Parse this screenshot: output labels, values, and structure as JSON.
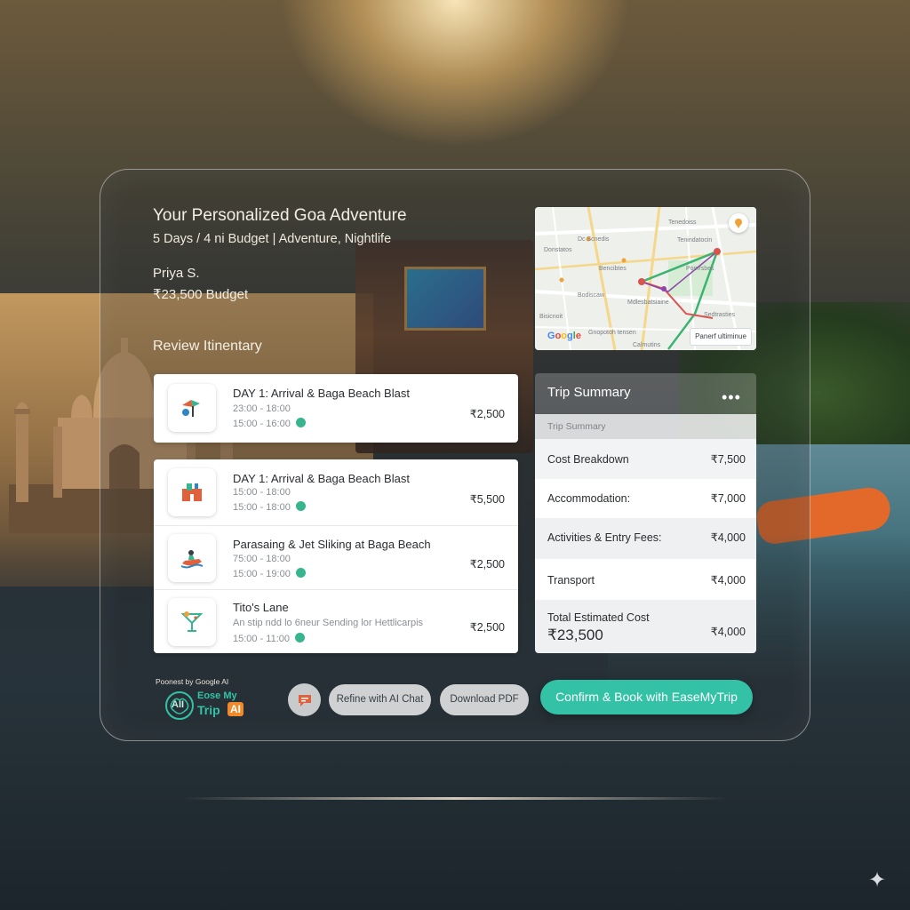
{
  "hero": {
    "title": "Your Personalized Goa Adventure",
    "subtitle": "5 Days / 4 ni Budget | Adventure, Nightlife",
    "user_name": "Priya S.",
    "user_budget": "₹23,500 Budget",
    "review_label": "Review Itinentary"
  },
  "itinerary": [
    {
      "title": "DAY 1: Arrival & Baga Beach Blast",
      "line1": "23:00 - 18:00",
      "line2": "15:00 - 16:00",
      "price": "₹2,500",
      "icon": "beach-icon"
    },
    {
      "title": "DAY 1: Arrival & Baga Beach Blast",
      "line1": "15:00 - 18:00",
      "line2": "15:00 - 18:00",
      "price": "₹5,500",
      "icon": "hotel-icon"
    },
    {
      "title": "Parasaing & Jet Sliking at Baga Beach",
      "line1": "75:00 - 18:00",
      "line2": "15:00 - 19:00",
      "price": "₹2,500",
      "icon": "jet-ski-icon"
    },
    {
      "title": "Tito's Lane",
      "line1": "An stip ndd lo 6neur Sending lor Hettlicarpis",
      "line2": "15:00 - 11:00",
      "price": "₹2,500",
      "icon": "cocktail-icon"
    }
  ],
  "map": {
    "labels": [
      "Dc Scnedis",
      "Tenindatocin",
      "Bencibtes",
      "Pomrsbes",
      "Bodiscaw",
      "Sedtrasties",
      "Mdlesbatsiaine",
      "Donstatos",
      "Bisicnoit",
      "Tenedoiss",
      "Gnopotoh tensen",
      "Calmutins"
    ],
    "google": "Google",
    "button": "Panerf ultiminue"
  },
  "summary": {
    "title": "Trip Summary",
    "more": "•••",
    "subtitle": "Trip Summary",
    "rows": [
      {
        "label": "Cost Breakdown",
        "value": "₹7,500"
      },
      {
        "label": "Accommodation:",
        "value": "₹7,000"
      },
      {
        "label": "Activities & Entry Fees:",
        "value": "₹4,000"
      },
      {
        "label": "Transport",
        "value": "₹4,000"
      }
    ],
    "total_label": "Total Estimated Cost",
    "total_value": "₹23,500",
    "total_right": "₹4,000"
  },
  "footer": {
    "powered": "Poonest by Google AI",
    "brand_line1": "Eose My",
    "brand_line2": "Trip",
    "brand_ai": "AI",
    "brand_badge": "AII",
    "refine": "Refine with AI Chat",
    "download": "Download PDF",
    "confirm": "Confirm & Book with EaseMyTrip"
  },
  "colors": {
    "accent": "#34c2a6",
    "pin": "#38b48f",
    "route_green": "#3cb371",
    "route_red": "#d9534f"
  }
}
